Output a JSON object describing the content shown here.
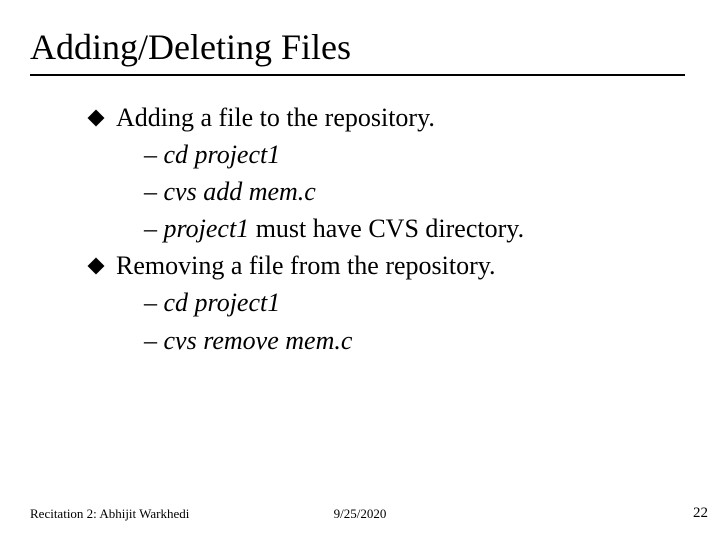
{
  "title": "Adding/Deleting Files",
  "bullets": [
    {
      "type": "l1",
      "text": "Adding a file to the repository."
    },
    {
      "type": "l2",
      "dash": "–",
      "italic": "cd project1"
    },
    {
      "type": "l2",
      "dash": "–",
      "italic": "cvs add mem.c"
    },
    {
      "type": "l2",
      "dash": "–",
      "italic": "project1",
      "rest": " must have CVS directory."
    },
    {
      "type": "l1",
      "text": "Removing a file from the repository."
    },
    {
      "type": "l2",
      "dash": "–",
      "italic": "cd project1"
    },
    {
      "type": "l2",
      "dash": "–",
      "italic": "cvs remove mem.c"
    }
  ],
  "footer": {
    "left": "Recitation 2: Abhijit Warkhedi",
    "center": "9/25/2020",
    "right": "22"
  }
}
